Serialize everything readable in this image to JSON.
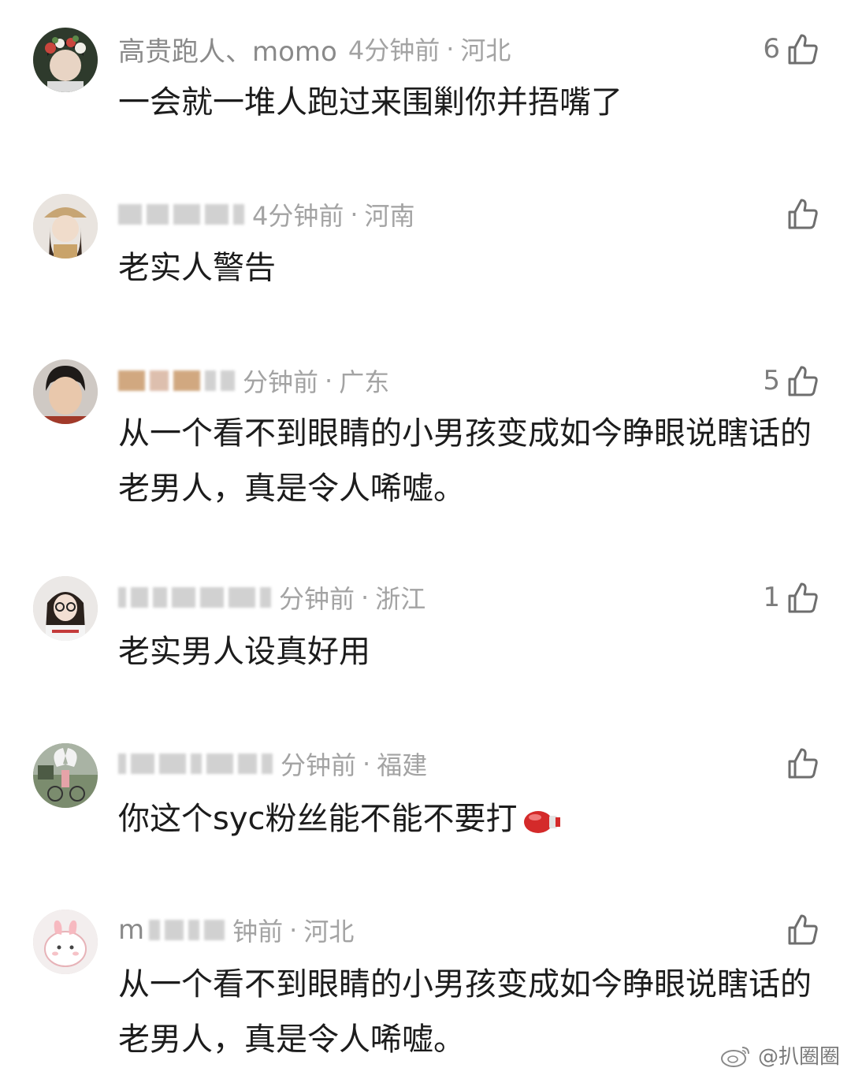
{
  "comments": [
    {
      "username": "高贵跑人、momo",
      "time": "4分钟前",
      "location": "河北",
      "text": "一会就一堆人跑过来围剿你并捂嘴了",
      "likes": "6",
      "avatar": "floral-girl-avatar"
    },
    {
      "username": "",
      "time": "4分钟前",
      "location": "河南",
      "text": "老实人警告",
      "likes": "",
      "avatar": "girl-hat-avatar"
    },
    {
      "username": "",
      "time": "分钟前",
      "location": "广东",
      "text": "从一个看不到眼睛的小男孩变成如今睁眼说瞎话的老男人，真是令人唏嘘。",
      "likes": "5",
      "avatar": "boy-avatar"
    },
    {
      "username": "",
      "time": "分钟前",
      "location": "浙江",
      "text": "老实男人设真好用",
      "likes": "1",
      "avatar": "girl-glasses-avatar"
    },
    {
      "username": "",
      "time": "分钟前",
      "location": "福建",
      "text": "你这个syc粉丝能不能不要打",
      "likes": "",
      "avatar": "angel-bike-avatar"
    },
    {
      "username": "m",
      "time": "钟前",
      "location": "河北",
      "text": "从一个看不到眼睛的小男孩变成如今睁眼说瞎话的老男人，真是令人唏嘘。",
      "likes": "",
      "avatar": "cartoon-bunny-avatar"
    }
  ],
  "separator": "·",
  "watermark": "@扒圈圈",
  "icons": {
    "like": "thumbs-up-icon",
    "emoji": "boxing-glove-icon",
    "weibo": "weibo-logo-icon"
  },
  "colors": {
    "text": "#1c1c1c",
    "meta": "#a3a3a3",
    "icon": "#6e6e6e"
  }
}
